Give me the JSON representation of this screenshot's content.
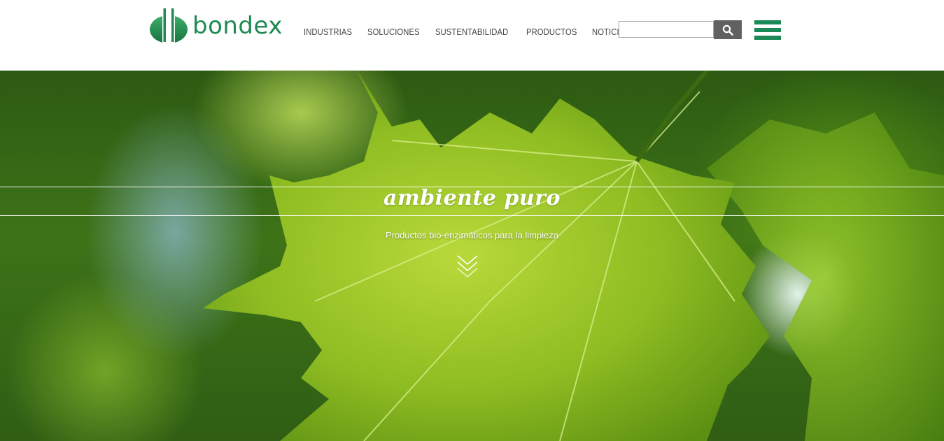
{
  "brand": {
    "name": "bondex",
    "color": "#1f8a52"
  },
  "nav": {
    "items": [
      {
        "label": "INDUSTRIAS"
      },
      {
        "label": "SOLUCIONES"
      },
      {
        "label": "SUSTENTABILIDAD"
      },
      {
        "label": "PRODUCTOS"
      },
      {
        "label": "NOTICIAS"
      }
    ]
  },
  "search": {
    "value": "",
    "placeholder": "",
    "icon": "search-icon"
  },
  "menu": {
    "icon": "hamburger-icon",
    "color": "#1b8a57"
  },
  "hero": {
    "title": "ambiente puro",
    "subtitle": "Productos bio-enzimáticos para la limpieza",
    "scroll_icon": "double-chevron-down-icon"
  }
}
